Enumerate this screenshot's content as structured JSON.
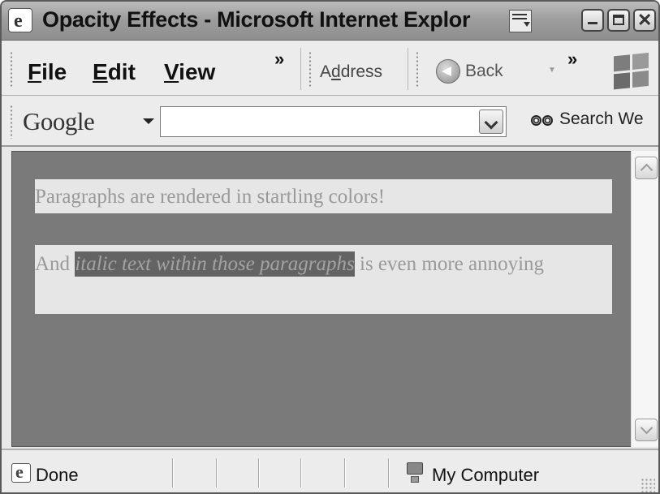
{
  "window": {
    "title": "Opacity Effects - Microsoft Internet Explor"
  },
  "menu": {
    "items": [
      {
        "label": "File",
        "accel": "F",
        "rest": "ile"
      },
      {
        "label": "Edit",
        "accel": "E",
        "rest": "dit"
      },
      {
        "label": "View",
        "accel": "V",
        "rest": "iew"
      }
    ],
    "overflow": "»"
  },
  "address": {
    "prefix": "A",
    "accel": "d",
    "suffix": "dress"
  },
  "nav": {
    "back_label": "Back",
    "overflow": "»"
  },
  "google_toolbar": {
    "logo": "Google",
    "search_value": "",
    "search_button": "Search We"
  },
  "page": {
    "para1": "Paragraphs are rendered in startling colors!",
    "para2_start": "And ",
    "para2_italic": "italic text within those paragraphs",
    "para2_end": " is even more annoying"
  },
  "status": {
    "text": "Done",
    "zone": "My Computer"
  },
  "colors": {
    "page_background": "#7a7a7a",
    "paragraph_background": "#e6e6e6",
    "paragraph_text": "#999999",
    "italic_background": "#636363"
  },
  "icons": [
    "ie-page-icon",
    "window-list-icon",
    "minimize-icon",
    "maximize-icon",
    "close-icon",
    "back-arrow-icon",
    "windows-logo-icon",
    "dropdown-icon",
    "binoculars-icon",
    "scroll-up-icon",
    "scroll-down-icon",
    "status-page-icon",
    "computer-icon"
  ]
}
